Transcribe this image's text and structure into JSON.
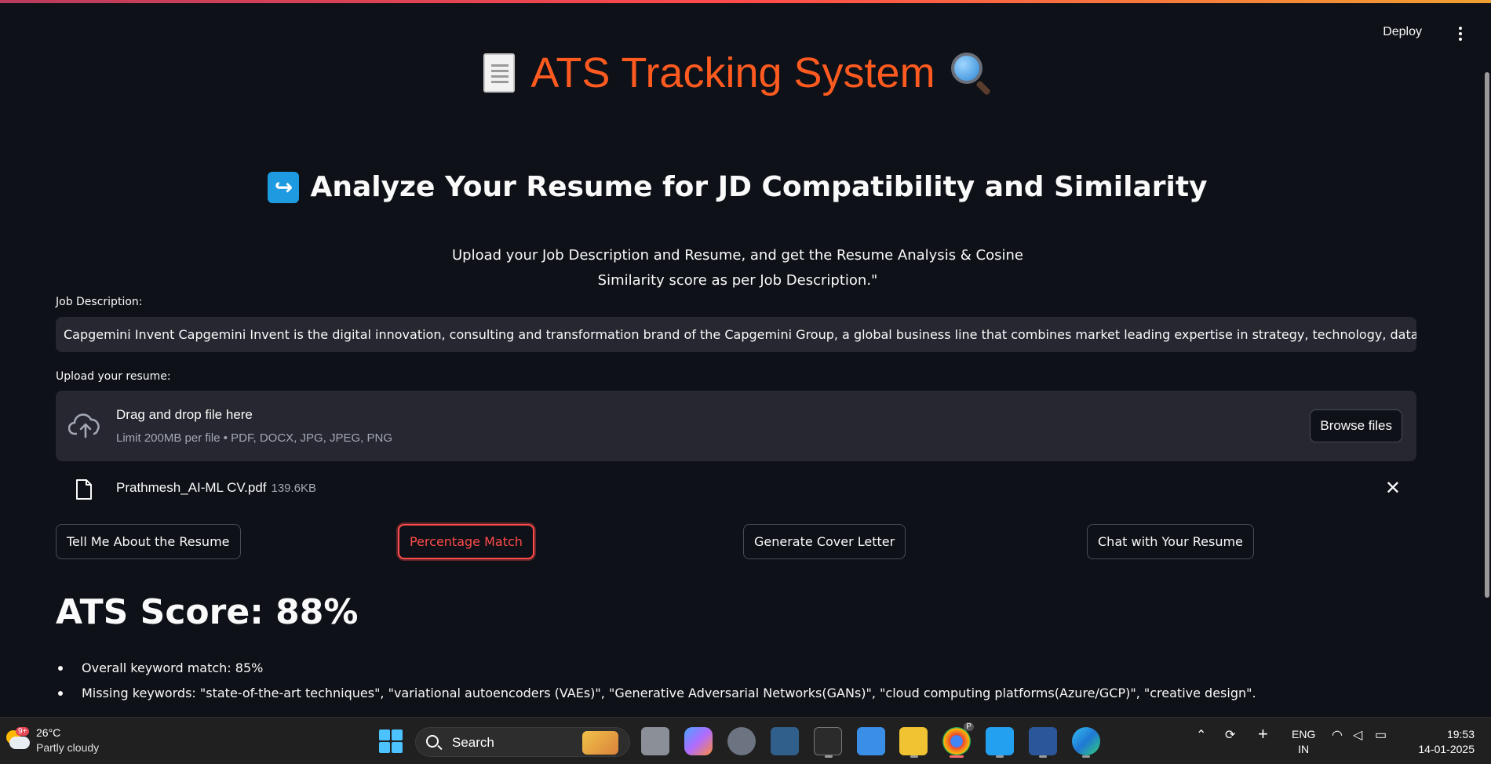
{
  "header": {
    "deploy_label": "Deploy"
  },
  "title": "ATS Tracking System",
  "subtitle": "Analyze Your Resume for JD Compatibility and Similarity",
  "intro_line1": "Upload your Job Description and Resume, and get the Resume Analysis & Cosine",
  "intro_line2": "Similarity score as per Job Description.\"",
  "job_description": {
    "label": "Job Description:",
    "value": "Capgemini Invent  Capgemini Invent is the digital innovation, consulting and transformation brand of the Capgemini Group, a global business line that combines market leading expertise in strategy, technology, data science and cre"
  },
  "resume_upload": {
    "label": "Upload your resume:",
    "drop_title": "Drag and drop file here",
    "limit_text": "Limit 200MB per file • PDF, DOCX, JPG, JPEG, PNG",
    "browse_label": "Browse files",
    "file_name": "Prathmesh_AI-ML CV.pdf",
    "file_size": "139.6KB"
  },
  "actions": {
    "tell_me": "Tell Me About the Resume",
    "percentage_match": "Percentage Match",
    "cover_letter": "Generate Cover Letter",
    "chat": "Chat with Your Resume"
  },
  "result": {
    "score_heading": "ATS Score: 88%",
    "bullets": [
      "Overall keyword match: 85%",
      "Missing keywords: \"state-of-the-art techniques\", \"variational autoencoders (VAEs)\", \"Generative Adversarial Networks(GANs)\", \"cloud computing platforms(Azure/GCP)\", \"creative design\"."
    ]
  },
  "taskbar": {
    "temperature": "26°C",
    "condition": "Partly cloudy",
    "weather_badge": "9+",
    "search_label": "Search",
    "language_1": "ENG",
    "language_2": "IN",
    "time": "19:53",
    "date": "14-01-2025",
    "chrome_badge": "P"
  },
  "colors": {
    "background": "#0e1117",
    "title": "#ff5a1f",
    "accent": "#ff4b4b",
    "input_bg": "#262730"
  }
}
